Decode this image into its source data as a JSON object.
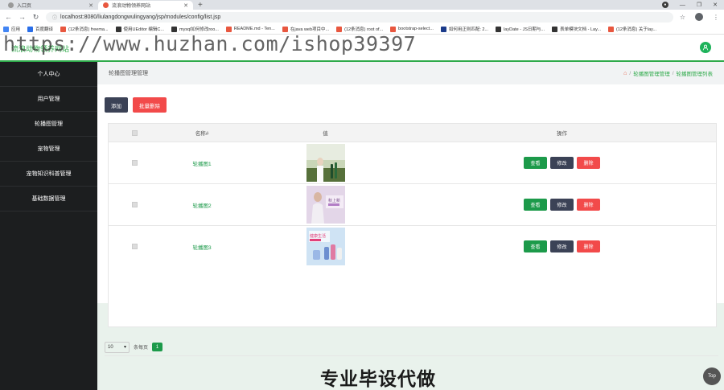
{
  "browser": {
    "tabs": [
      {
        "label": "入口页",
        "active": false
      },
      {
        "label": "流浪动物领养网站",
        "active": true
      }
    ],
    "url": "localhost:8080/liulangdongwulingyang/jsp/modules/config/list.jsp",
    "bookmarks": [
      {
        "label": "应用",
        "color": "#4285f4"
      },
      {
        "label": "百度翻译",
        "color": "#2a6ee8"
      },
      {
        "label": "(12条消息) freema...",
        "color": "#e8573f"
      },
      {
        "label": "使用UEditor 编辑C...",
        "color": "#333333"
      },
      {
        "label": "mysql如何修改roo...",
        "color": "#333333"
      },
      {
        "label": "README.md - Ten...",
        "color": "#e8573f"
      },
      {
        "label": "在java web项目中...",
        "color": "#e8573f"
      },
      {
        "label": "(12条消息) root of...",
        "color": "#e8573f"
      },
      {
        "label": "bootstrap-select...",
        "color": "#e8573f"
      },
      {
        "label": "如何用正则匹配: 2...",
        "color": "#1a3a8a"
      },
      {
        "label": "layDate - JS日期与...",
        "color": "#333333"
      },
      {
        "label": "表单模块文档 - Lay...",
        "color": "#333333"
      },
      {
        "label": "(12条消息) 关于lay...",
        "color": "#e8573f"
      }
    ]
  },
  "header": {
    "site_title": "流浪动物领养网站",
    "watermark": "https://www.huzhan.com/ishop39397"
  },
  "sidebar": {
    "items": [
      {
        "label": "个人中心"
      },
      {
        "label": "用户管理"
      },
      {
        "label": "轮播图管理"
      },
      {
        "label": "宠物管理"
      },
      {
        "label": "宠物知识科普管理"
      },
      {
        "label": "基础数据管理"
      }
    ]
  },
  "main": {
    "page_title": "轮播图管理管理",
    "breadcrumb": {
      "level1": "轮播图管理管理",
      "separator": "/",
      "level2": "轮播图管理列表"
    },
    "actions": {
      "add": "添加",
      "batch_delete": "批量删除"
    },
    "table": {
      "headers": {
        "name": "名称#",
        "value": "值",
        "ops": "操作"
      },
      "rows": [
        {
          "name": "轮播图1",
          "thumb": "model-greenery"
        },
        {
          "name": "轮播图2",
          "thumb": "pink-ad-banner",
          "thumb_text": "秋上新"
        },
        {
          "name": "轮播图3",
          "thumb": "blue-product-banner",
          "thumb_text": "健康生活"
        }
      ],
      "op_labels": {
        "view": "查看",
        "edit": "修改",
        "delete": "删除"
      }
    },
    "pager": {
      "page_size": "10",
      "per_page_label": "条每页",
      "current_page": "1"
    },
    "promo_text": "专业毕设代做",
    "top_button": "Top"
  },
  "colors": {
    "accent": "#2eaa4a",
    "danger": "#f24a4a",
    "dark_button": "#3b4256",
    "sidebar": "#1c1e1f"
  }
}
